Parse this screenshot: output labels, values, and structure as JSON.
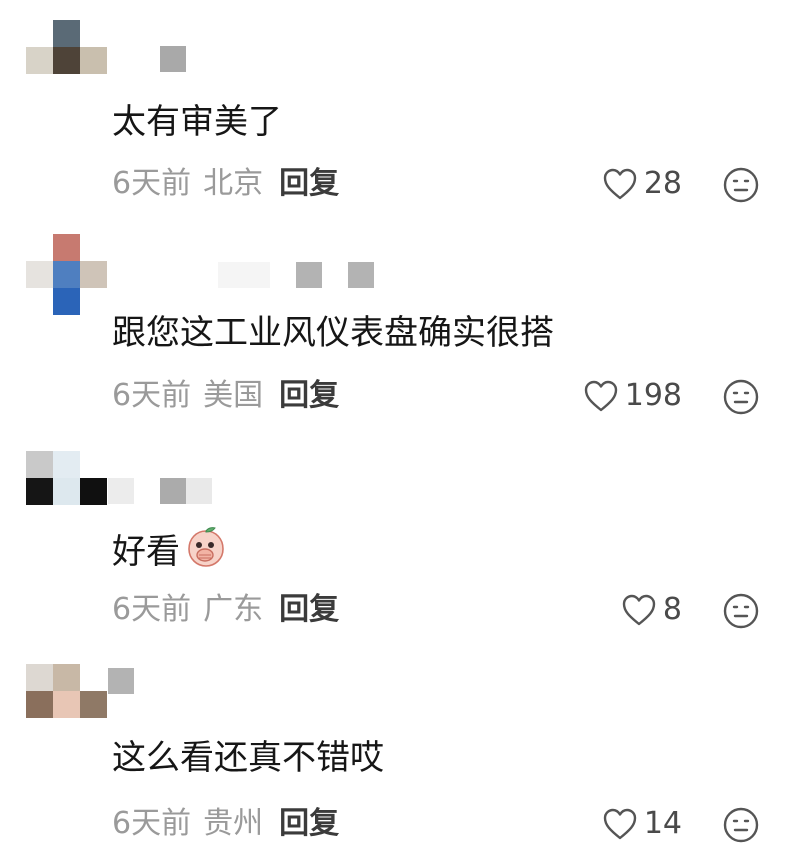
{
  "comments": [
    {
      "text": "太有审美了",
      "time": "6天前",
      "location": "北京",
      "reply_label": "回复",
      "likes": "28",
      "avatar_colors": [
        [
          "#ffffff",
          "#5a6a76",
          "#ffffff"
        ],
        [
          "#d8d3c8",
          "#4e4338",
          "#c9bfae"
        ]
      ],
      "name_colors": [
        "#a9a9a9"
      ]
    },
    {
      "text": "跟您这工业风仪表盘确实很搭",
      "time": "6天前",
      "location": "美国",
      "reply_label": "回复",
      "likes": "198",
      "avatar_colors": [
        [
          "#ffffff",
          "#c77a70",
          "#ffffff"
        ],
        [
          "#e6e3df",
          "#4f7fc0",
          "#cfc4b8"
        ],
        [
          "#ffffff",
          "#2b64b8",
          "#ffffff"
        ]
      ],
      "name_colors": [
        "#f5f5f5",
        "#b3b3b3",
        "#ffffff",
        "#b3b3b3"
      ]
    },
    {
      "text": "好看",
      "time": "6天前",
      "location": "广东",
      "reply_label": "回复",
      "likes": "8",
      "avatar_colors": [
        [
          "#c9c9c9",
          "#e3ecf2",
          "#ffffff"
        ],
        [
          "#151515",
          "#dde8ee",
          "#101010"
        ]
      ],
      "name_colors": [
        "#ececec",
        "#ffffff",
        "#ababab",
        "#e9e9e9"
      ]
    },
    {
      "text": "这么看还真不错哎",
      "time": "6天前",
      "location": "贵州",
      "reply_label": "回复",
      "likes": "14",
      "avatar_colors": [
        [
          "#ddd8d2",
          "#c8b8a6",
          "#ffffff"
        ],
        [
          "#8a6f5c",
          "#e8c6b5",
          "#8f7966"
        ]
      ],
      "name_colors": [
        "#b3b3b3"
      ]
    }
  ],
  "icons": {
    "like": "heart-outline-icon",
    "react": "face-emoji-icon",
    "inline_emoji": "peach-covering-mouth-emoji"
  },
  "colors": {
    "meta_text": "#9a9a9a",
    "reply_text": "#3b3b3b",
    "content_text": "#161616",
    "icon_stroke": "#555555"
  }
}
